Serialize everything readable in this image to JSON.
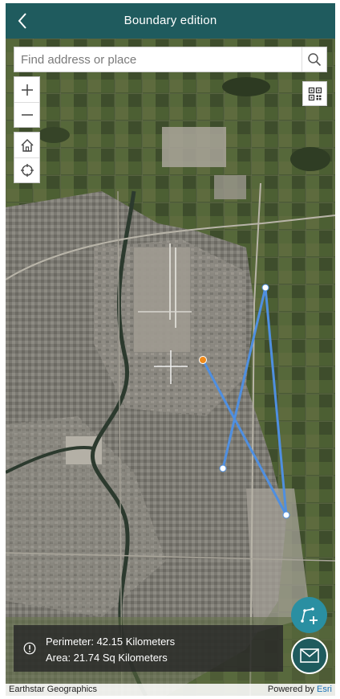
{
  "header": {
    "title": "Boundary edition",
    "back_icon": "chevron-left-icon"
  },
  "search": {
    "placeholder": "Find address or place",
    "value": "",
    "icon": "search-icon"
  },
  "map_controls": {
    "zoom_in_icon": "plus-icon",
    "zoom_out_icon": "minus-icon",
    "home_icon": "home-icon",
    "locate_icon": "locate-icon",
    "qr_icon": "qr-code-icon"
  },
  "measurement": {
    "perimeter": "Perimeter: 42.15 Kilometers",
    "area": "Area: 21.74 Sq Kilometers",
    "info_icon": "info-icon"
  },
  "actions": {
    "add_vertex_icon": "add-vertex-icon",
    "mail_icon": "mail-icon"
  },
  "attribution": {
    "source": "Earthstar Geographics",
    "powered_by": "Powered by",
    "brand": "Esri"
  },
  "colors": {
    "header": "#1f5b5e",
    "accent": "#2a8fa2",
    "boundary_line": "#4f8fe0",
    "active_vertex": "#f08a1a",
    "vertex": "#ffffff"
  }
}
